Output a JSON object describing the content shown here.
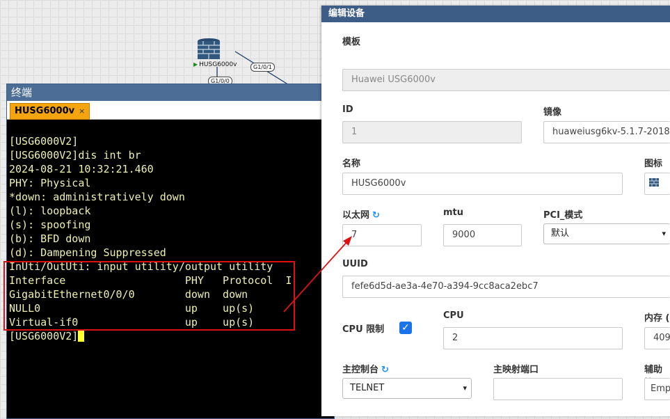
{
  "topology": {
    "node_label": "HUSG6000v",
    "port_tags": [
      "G1/0/1",
      "G1/0/0"
    ]
  },
  "terminal": {
    "title": "终端",
    "tab_label": "HUSG6000v",
    "tab_close": "×",
    "lines": [
      "[USG6000V2]",
      "[USG6000V2]dis int br",
      "2024-08-21 10:32:21.460",
      "PHY: Physical",
      "*down: administratively down",
      "(l): loopback",
      "(s): spoofing",
      "(b): BFD down",
      "(d): Dampening Suppressed",
      "InUti/OutUti: input utility/output utility",
      "Interface                   PHY   Protocol  I",
      "GigabitEthernet0/0/0        down  down",
      "NULL0                       up    up(s)",
      "Virtual-if0                 up    up(s)"
    ],
    "prompt": "[USG6000V2]"
  },
  "panel": {
    "title": "编辑设备",
    "template_label": "模板",
    "template_value": "Huawei USG6000v",
    "id_label": "ID",
    "id_value": "1",
    "image_label": "镜像",
    "image_value": "huaweiusg6kv-5.1.7-2018",
    "name_label": "名称",
    "name_value": "HUSG6000v",
    "icon_label": "图标",
    "ethernet_label": "以太网",
    "ethernet_value": "7",
    "mtu_label": "mtu",
    "mtu_value": "9000",
    "pci_label": "PCI_模式",
    "pci_value": "默认",
    "uuid_label": "UUID",
    "uuid_value": "fefe6d5d-ae3a-4e70-a394-9cc8aca2ebc7",
    "cpu_limit_label": "CPU 限制",
    "cpu_label": "CPU",
    "cpu_value": "2",
    "memory_label": "内存 (",
    "memory_value": "409",
    "console_label": "主控制台",
    "console_value": "TELNET",
    "main_port_label": "主映射端口",
    "main_port_value": "",
    "aux_label": "辅助控",
    "aux_value": "Emp"
  },
  "colors": {
    "terminal_text": "#f0f0b0",
    "tab_accent": "#f3a40f",
    "panel_header": "#3e5d86",
    "highlight": "#dd1111",
    "checkbox": "#1a73e8"
  }
}
